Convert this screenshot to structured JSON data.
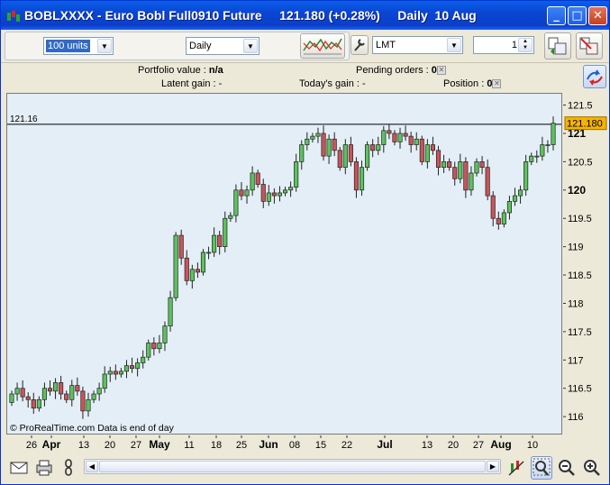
{
  "window": {
    "title": "BOBLXXXX - Euro Bobl Full0910 Future     121.180 (+0.28%)     Daily  10 Aug",
    "minimize": "_",
    "maximize": "□",
    "close": "✕"
  },
  "toolbar": {
    "units_value": "100 units",
    "period_value": "Daily",
    "order_type_value": "LMT",
    "quantity_value": "1"
  },
  "info": {
    "portfolio_label": "Portfolio value :",
    "portfolio_value": "n/a",
    "latent_label": "Latent gain :",
    "latent_value": "-",
    "today_label": "Today's gain :",
    "today_value": "-",
    "pending_label": "Pending orders :",
    "pending_value": "0",
    "position_label": "Position :",
    "position_value": "0"
  },
  "chart_data": {
    "type": "candlestick",
    "title": "",
    "price_line_value": 121.16,
    "price_line_label": "121.16",
    "last_price_label": "121.180",
    "ylim": [
      115.7,
      121.7
    ],
    "y_ticks": [
      "121.5",
      "121",
      "120.5",
      "120",
      "119.5",
      "119",
      "118.5",
      "118",
      "117.5",
      "117",
      "116.5",
      "116"
    ],
    "y_bold": [
      "121",
      "120"
    ],
    "x_ticks": [
      {
        "label": "26",
        "bold": false
      },
      {
        "label": "Apr",
        "bold": true
      },
      {
        "label": "13",
        "bold": false
      },
      {
        "label": "20",
        "bold": false
      },
      {
        "label": "27",
        "bold": false
      },
      {
        "label": "May",
        "bold": true
      },
      {
        "label": "11",
        "bold": false
      },
      {
        "label": "18",
        "bold": false
      },
      {
        "label": "25",
        "bold": false
      },
      {
        "label": "Jun",
        "bold": true
      },
      {
        "label": "08",
        "bold": false
      },
      {
        "label": "15",
        "bold": false
      },
      {
        "label": "22",
        "bold": false
      },
      {
        "label": "Jul",
        "bold": true
      },
      {
        "label": "13",
        "bold": false
      },
      {
        "label": "20",
        "bold": false
      },
      {
        "label": "27",
        "bold": false
      },
      {
        "label": "Aug",
        "bold": true
      },
      {
        "label": "10",
        "bold": false
      }
    ],
    "closes": [
      116.4,
      116.5,
      116.35,
      116.3,
      116.15,
      116.3,
      116.5,
      116.45,
      116.6,
      116.4,
      116.3,
      116.55,
      116.45,
      116.1,
      116.3,
      116.4,
      116.5,
      116.75,
      116.8,
      116.75,
      116.8,
      116.9,
      116.85,
      116.95,
      117.05,
      117.3,
      117.2,
      117.3,
      117.6,
      118.1,
      119.2,
      118.8,
      118.4,
      118.6,
      118.55,
      118.9,
      118.9,
      119.2,
      119.0,
      119.5,
      119.55,
      120.0,
      119.9,
      120.0,
      120.3,
      120.1,
      119.8,
      119.95,
      119.9,
      119.95,
      120.0,
      120.05,
      120.5,
      120.8,
      120.9,
      120.95,
      121.0,
      120.6,
      120.9,
      120.7,
      120.4,
      120.8,
      120.5,
      120.0,
      120.4,
      120.8,
      120.7,
      120.8,
      121.05,
      121.0,
      120.85,
      121.0,
      120.95,
      120.8,
      120.9,
      120.5,
      120.8,
      120.7,
      120.4,
      120.5,
      120.4,
      120.2,
      120.5,
      120.0,
      120.3,
      120.5,
      120.4,
      119.9,
      119.5,
      119.4,
      119.6,
      119.8,
      119.9,
      120.0,
      120.5,
      120.6,
      120.6,
      120.8,
      120.8,
      121.18
    ],
    "first_open": 116.25,
    "chart_note": "© ProRealTime.com  Data is end of day"
  }
}
